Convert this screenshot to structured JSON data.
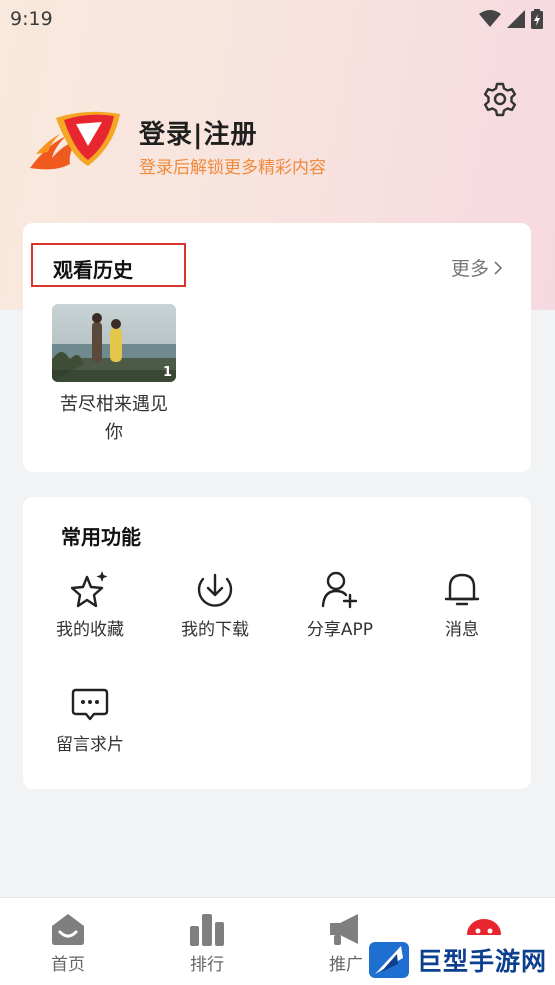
{
  "status_bar": {
    "time": "9:19"
  },
  "profile": {
    "title": "登录|注册",
    "subtitle": "登录后解锁更多精彩内容"
  },
  "history": {
    "title": "观看历史",
    "more_label": "更多",
    "items": [
      {
        "title": "苦尽柑来遇见你",
        "episode": "1"
      }
    ]
  },
  "functions": {
    "title": "常用功能",
    "items": [
      {
        "label": "我的收藏",
        "icon": "star-sparkle-icon"
      },
      {
        "label": "我的下载",
        "icon": "download-icon"
      },
      {
        "label": "分享APP",
        "icon": "add-user-icon"
      },
      {
        "label": "消息",
        "icon": "bell-icon"
      },
      {
        "label": "留言求片",
        "icon": "chat-bubble-icon"
      }
    ]
  },
  "tab_bar": {
    "items": [
      {
        "label": "首页",
        "icon": "home-icon"
      },
      {
        "label": "排行",
        "icon": "ranking-icon"
      },
      {
        "label": "推广",
        "icon": "megaphone-icon"
      }
    ]
  },
  "watermark": {
    "text": "巨型手游网"
  },
  "colors": {
    "accent_orange": "#f08a3c",
    "highlight_red": "#d9342b",
    "brand_red": "#e8262f"
  }
}
